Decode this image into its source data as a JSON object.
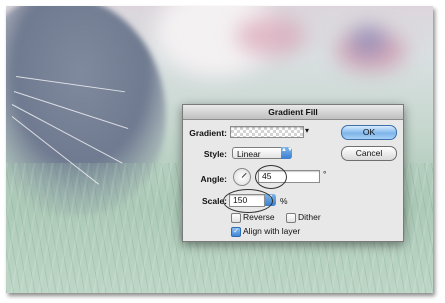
{
  "dialog": {
    "title": "Gradient Fill",
    "gradient_label": "Gradient:",
    "style_label": "Style:",
    "style_value": "Linear",
    "angle_label": "Angle:",
    "angle_value": "45",
    "angle_unit": "°",
    "scale_label": "Scale:",
    "scale_value": "150",
    "scale_unit": "%",
    "reverse_label": "Reverse",
    "reverse_checked": false,
    "dither_label": "Dither",
    "dither_checked": false,
    "align_label": "Align with layer",
    "align_checked": true,
    "ok_label": "OK",
    "cancel_label": "Cancel"
  },
  "icons": {
    "checkmark": "✓",
    "dropdown_arrows": "▲▼",
    "gradient_picker_arrow": "▾"
  },
  "colors": {
    "default_button": "#7fb5ea",
    "dialog_background": "#e8e8e8",
    "accent_blue": "#3a7fd0"
  }
}
